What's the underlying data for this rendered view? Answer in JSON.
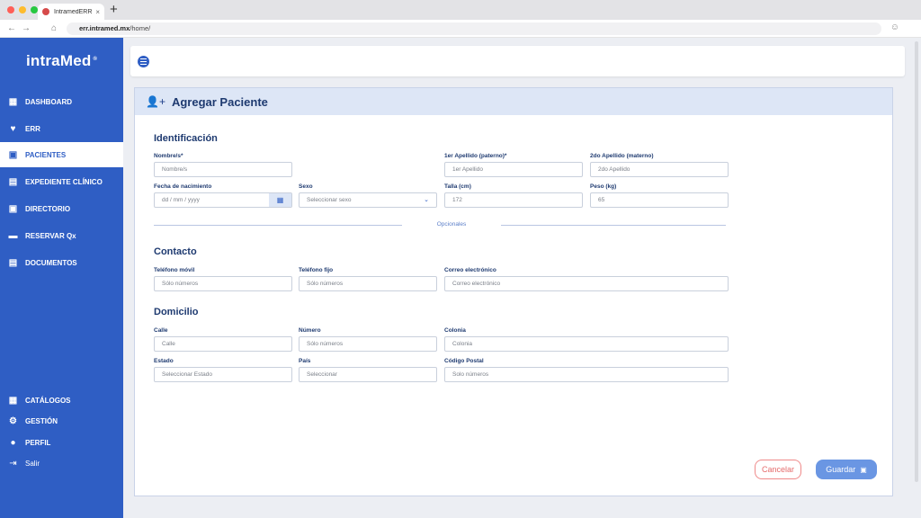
{
  "browser": {
    "tab_title": "IntramedERR",
    "tab_close": "×",
    "new_tab": "+",
    "url_host": "err.intramed.mx",
    "url_path": "/home/"
  },
  "sidebar": {
    "logo": "intraMed",
    "logo_mark": "®",
    "items": [
      {
        "label": "DASHBOARD",
        "icon": "grid-icon",
        "glyph": "▦"
      },
      {
        "label": "ERR",
        "icon": "heart-pulse-icon",
        "glyph": "♥"
      },
      {
        "label": "PACIENTES",
        "icon": "patient-card-icon",
        "glyph": "▣"
      },
      {
        "label": "EXPEDIENTE CLÍNICO",
        "icon": "file-icon",
        "glyph": "▤"
      },
      {
        "label": "DIRECTORIO",
        "icon": "directory-icon",
        "glyph": "▣"
      },
      {
        "label": "RESERVAR Qx",
        "icon": "bed-icon",
        "glyph": "▬"
      },
      {
        "label": "DOCUMENTOS",
        "icon": "documents-icon",
        "glyph": "▤"
      }
    ],
    "bottom_items": [
      {
        "label": "CATÁLOGOS",
        "icon": "grid-icon",
        "glyph": "▦"
      },
      {
        "label": "GESTIÓN",
        "icon": "gear-icon",
        "glyph": "⚙"
      },
      {
        "label": "PERFIL",
        "icon": "user-icon",
        "glyph": "●"
      },
      {
        "label": "Salir",
        "icon": "logout-icon",
        "glyph": "⇥"
      }
    ]
  },
  "form": {
    "title": "Agregar Paciente",
    "sections": {
      "identificacion": "Identificación",
      "contacto": "Contacto",
      "domicilio": "Domicilio"
    },
    "divider": "Opcionales",
    "fields": {
      "nombre": {
        "label": "Nombre/s*",
        "placeholder": "Nombre/s"
      },
      "apellido1": {
        "label": "1er Apellido (paterno)*",
        "placeholder": "1er Apellido"
      },
      "apellido2": {
        "label": "2do Apellido (materno)",
        "placeholder": "2do Apellido"
      },
      "fecha": {
        "label": "Fecha de nacimiento",
        "placeholder": "dd / mm / yyyy"
      },
      "sexo": {
        "label": "Sexo",
        "placeholder": "Seleccionar sexo"
      },
      "talla": {
        "label": "Talla (cm)",
        "value": "172"
      },
      "peso": {
        "label": "Peso (kg)",
        "value": "65"
      },
      "movil": {
        "label": "Teléfono móvil",
        "placeholder": "Sólo números"
      },
      "fijo": {
        "label": "Teléfono fijo",
        "placeholder": "Sólo números"
      },
      "correo": {
        "label": "Correo electrónico",
        "placeholder": "Correo electrónico"
      },
      "calle": {
        "label": "Calle",
        "placeholder": "Calle"
      },
      "numero": {
        "label": "Número",
        "placeholder": "Sólo números"
      },
      "colonia": {
        "label": "Colonia",
        "placeholder": "Colonia"
      },
      "estado": {
        "label": "Estado",
        "placeholder": "Seleccionar Estado"
      },
      "pais": {
        "label": "País",
        "placeholder": "Seleccionar"
      },
      "cp": {
        "label": "Código Postal",
        "placeholder": "Solo números"
      }
    },
    "buttons": {
      "cancel": "Cancelar",
      "save": "Guardar"
    }
  },
  "colors": {
    "brand": "#2f5ec4",
    "cancel": "#e56b6b",
    "save": "#6a96e3"
  }
}
